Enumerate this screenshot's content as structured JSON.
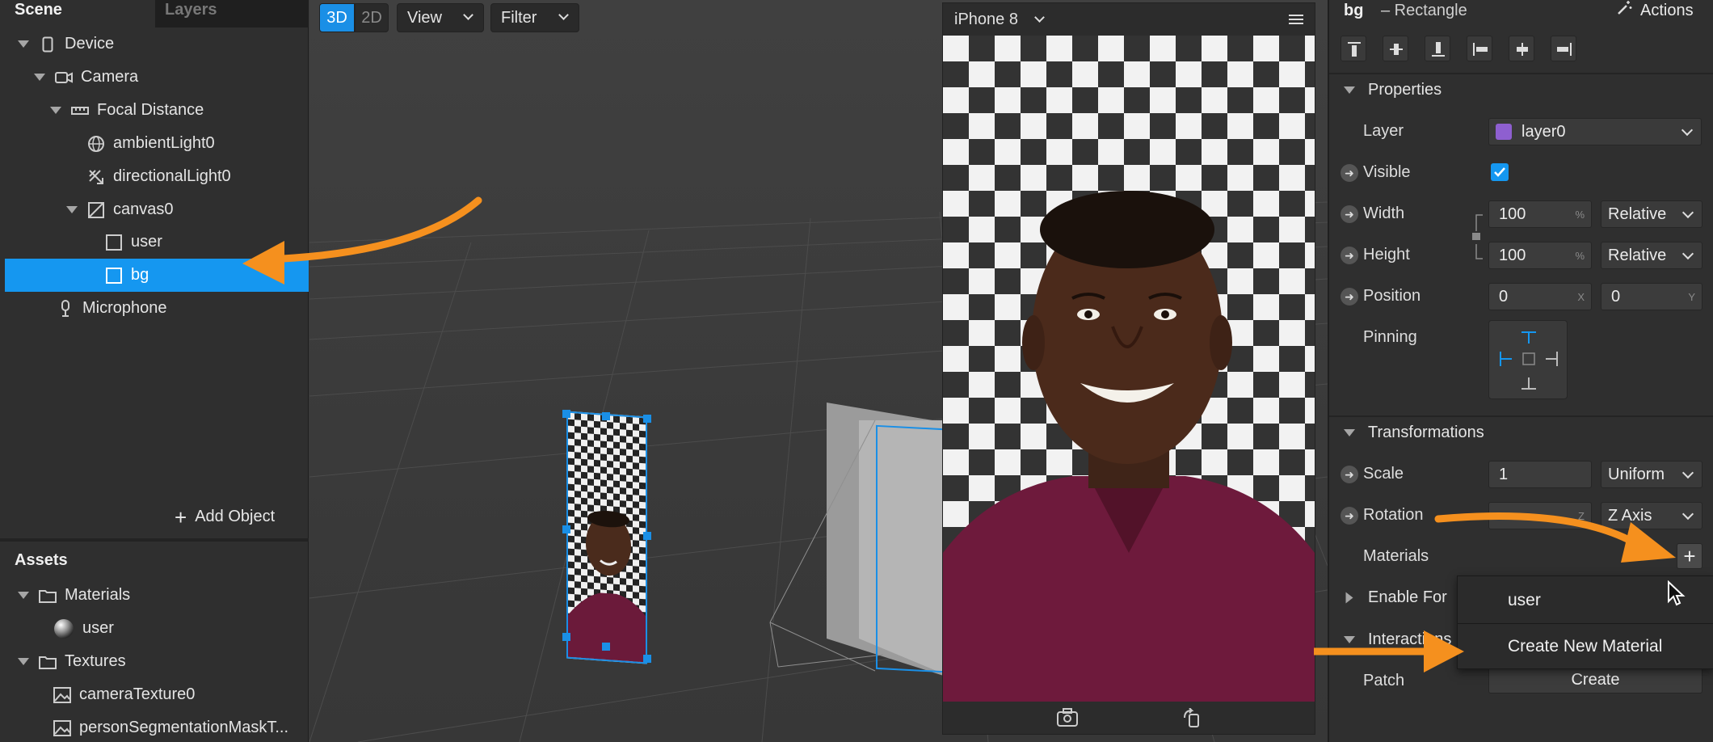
{
  "scene_panel": {
    "tabs": [
      "Scene",
      "Layers"
    ],
    "tree": [
      {
        "label": "Device",
        "icon": "phone-icon"
      },
      {
        "label": "Camera",
        "icon": "camera-icon"
      },
      {
        "label": "Focal Distance",
        "icon": "ruler-icon"
      },
      {
        "label": "ambientLight0",
        "icon": "globe-icon"
      },
      {
        "label": "directionalLight0",
        "icon": "directional-light-icon"
      },
      {
        "label": "canvas0",
        "icon": "canvas-icon"
      },
      {
        "label": "user",
        "icon": "rectangle-icon"
      },
      {
        "label": "bg",
        "icon": "rectangle-icon"
      },
      {
        "label": "Microphone",
        "icon": "microphone-icon"
      }
    ],
    "add_object": "Add Object"
  },
  "assets_panel": {
    "title": "Assets",
    "items": [
      {
        "label": "Materials",
        "icon": "folder-icon"
      },
      {
        "label": "user",
        "icon": "material-sphere-icon"
      },
      {
        "label": "Textures",
        "icon": "folder-icon"
      },
      {
        "label": "cameraTexture0",
        "icon": "image-icon"
      },
      {
        "label": "personSegmentationMaskT...",
        "icon": "image-icon"
      }
    ]
  },
  "viewport": {
    "mode_3d": "3D",
    "mode_2d": "2D",
    "view_menu": "View",
    "filter_menu": "Filter"
  },
  "preview": {
    "device": "iPhone 8"
  },
  "inspector": {
    "object_name": "bg",
    "object_type": "– Rectangle",
    "actions": "Actions",
    "properties_title": "Properties",
    "layer_label": "Layer",
    "layer_value": "layer0",
    "layer_color": "#8e5fd0",
    "visible_label": "Visible",
    "visible_checked": true,
    "width_label": "Width",
    "width_value": "100",
    "width_unit": "%",
    "width_mode": "Relative",
    "height_label": "Height",
    "height_value": "100",
    "height_unit": "%",
    "height_mode": "Relative",
    "position_label": "Position",
    "position_x": "0",
    "position_x_unit": "X",
    "position_y": "0",
    "position_y_unit": "Y",
    "pinning_label": "Pinning",
    "transformations_title": "Transformations",
    "scale_label": "Scale",
    "scale_value": "1",
    "scale_mode": "Uniform",
    "rotation_label": "Rotation",
    "rotation_unit": "Z",
    "rotation_axis": "Z Axis",
    "materials_label": "Materials",
    "enable_for_label": "Enable For",
    "interactions_label": "Interactions",
    "patch_label": "Patch",
    "patch_button": "Create"
  },
  "materials_menu": {
    "items": [
      "user",
      "Create New Material"
    ]
  },
  "colors": {
    "accent": "#1597f0",
    "annotation_arrow": "#f5901e"
  }
}
